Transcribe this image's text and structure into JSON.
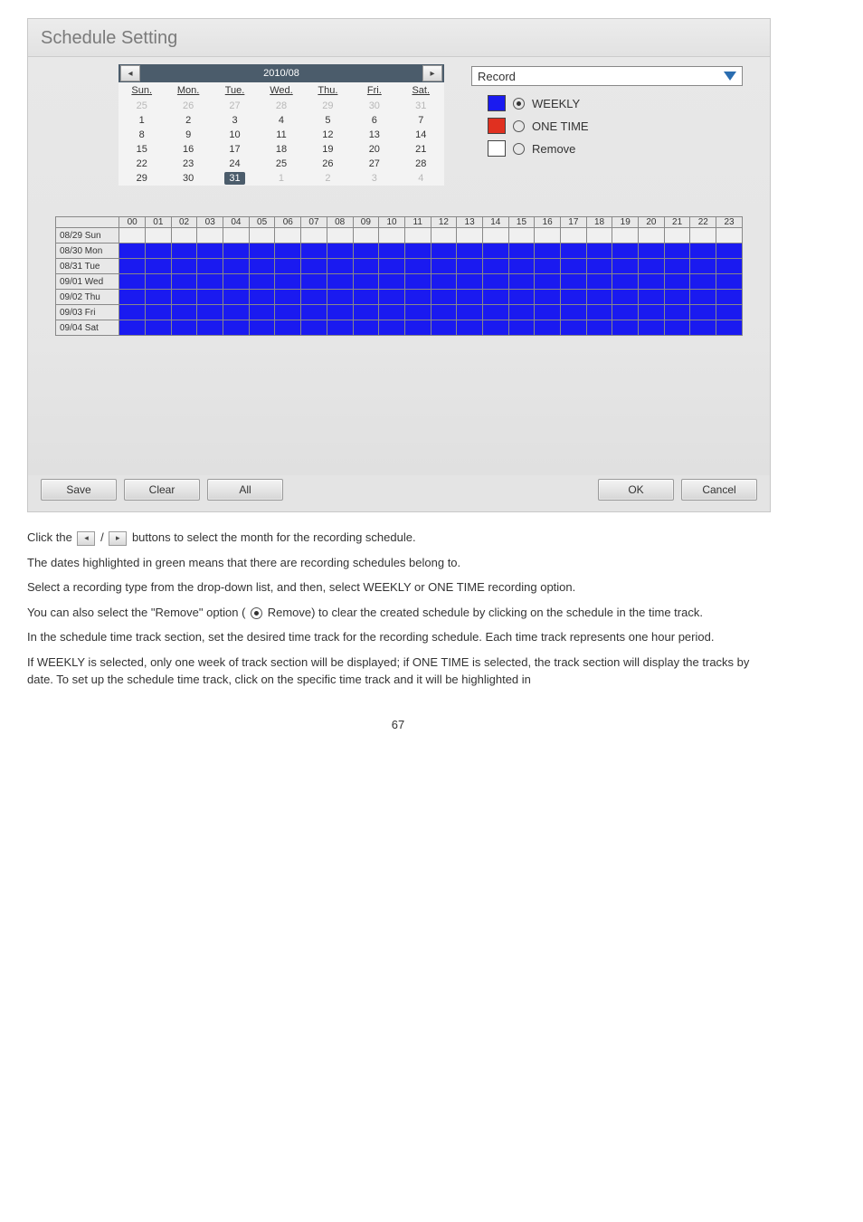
{
  "title": "Schedule Setting",
  "calendar": {
    "month_label": "2010/08",
    "days": [
      "Sun.",
      "Mon.",
      "Tue.",
      "Wed.",
      "Thu.",
      "Fri.",
      "Sat."
    ],
    "rows": [
      [
        {
          "n": "25",
          "dim": true
        },
        {
          "n": "26",
          "dim": true
        },
        {
          "n": "27",
          "dim": true
        },
        {
          "n": "28",
          "dim": true
        },
        {
          "n": "29",
          "dim": true
        },
        {
          "n": "30",
          "dim": true
        },
        {
          "n": "31",
          "dim": true
        }
      ],
      [
        {
          "n": "1"
        },
        {
          "n": "2"
        },
        {
          "n": "3"
        },
        {
          "n": "4"
        },
        {
          "n": "5"
        },
        {
          "n": "6"
        },
        {
          "n": "7"
        }
      ],
      [
        {
          "n": "8"
        },
        {
          "n": "9"
        },
        {
          "n": "10"
        },
        {
          "n": "11"
        },
        {
          "n": "12"
        },
        {
          "n": "13"
        },
        {
          "n": "14"
        }
      ],
      [
        {
          "n": "15"
        },
        {
          "n": "16"
        },
        {
          "n": "17"
        },
        {
          "n": "18"
        },
        {
          "n": "19"
        },
        {
          "n": "20"
        },
        {
          "n": "21"
        }
      ],
      [
        {
          "n": "22"
        },
        {
          "n": "23"
        },
        {
          "n": "24"
        },
        {
          "n": "25"
        },
        {
          "n": "26"
        },
        {
          "n": "27"
        },
        {
          "n": "28"
        }
      ],
      [
        {
          "n": "29"
        },
        {
          "n": "30"
        },
        {
          "n": "31",
          "sel": true
        },
        {
          "n": "1",
          "dim": true
        },
        {
          "n": "2",
          "dim": true
        },
        {
          "n": "3",
          "dim": true
        },
        {
          "n": "4",
          "dim": true
        }
      ]
    ]
  },
  "record_dropdown": "Record",
  "legend": {
    "weekly": {
      "label": "WEEKLY",
      "color": "#1a1af0",
      "selected": true
    },
    "one_time": {
      "label": "ONE TIME",
      "color": "#e03020",
      "selected": false
    },
    "remove": {
      "label": "Remove",
      "color": "#ffffff",
      "selected": false
    }
  },
  "hours": [
    "00",
    "01",
    "02",
    "03",
    "04",
    "05",
    "06",
    "07",
    "08",
    "09",
    "10",
    "11",
    "12",
    "13",
    "14",
    "15",
    "16",
    "17",
    "18",
    "19",
    "20",
    "21",
    "22",
    "23"
  ],
  "schedule_rows": [
    {
      "label": "08/29 Sun",
      "filled": false
    },
    {
      "label": "08/30 Mon",
      "filled": true
    },
    {
      "label": "08/31 Tue",
      "filled": true
    },
    {
      "label": "09/01 Wed",
      "filled": true
    },
    {
      "label": "09/02 Thu",
      "filled": true
    },
    {
      "label": "09/03 Fri",
      "filled": true
    },
    {
      "label": "09/04 Sat",
      "filled": true
    }
  ],
  "buttons": {
    "save": "Save",
    "clear": "Clear",
    "all": "All",
    "ok": "OK",
    "cancel": "Cancel"
  },
  "doc": {
    "p1_a": "Click the ",
    "p1_b": " buttons to select the month for the recording schedule.",
    "p2": "The dates highlighted in green means that there are recording schedules belong to.",
    "p3": "Select a recording type from the drop-down list, and then, select WEEKLY or ONE TIME recording option.",
    "p4_a": "You can also select the \"Remove\" option (",
    "p4_b": " Remove) to clear the created schedule by clicking on the schedule in the time track.",
    "p5": "In the schedule time track section, set the desired time track for the recording schedule. Each time track represents one hour period.",
    "p6": "If WEEKLY is selected, only one week of track section will be displayed; if ONE TIME is selected, the track section will display the tracks by date. To set up the schedule time track, click on the specific time track and it will be highlighted in",
    "page": "67"
  }
}
